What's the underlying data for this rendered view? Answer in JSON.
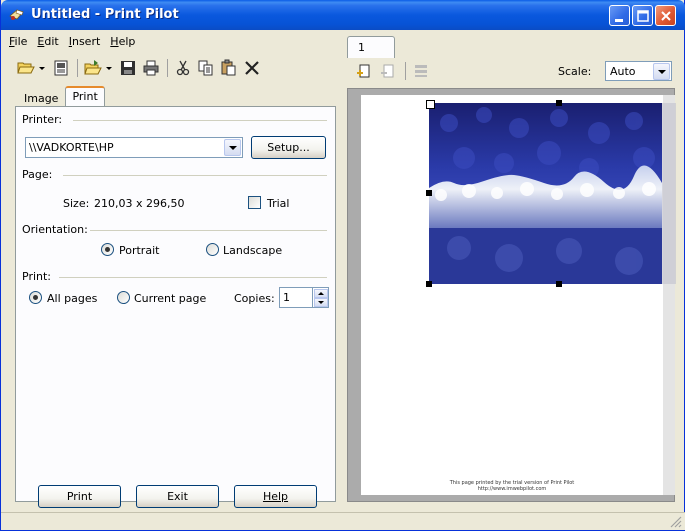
{
  "window": {
    "title": "Untitled - Print Pilot"
  },
  "menu": {
    "items": [
      {
        "label": "File",
        "accel": "F",
        "rest": "ile"
      },
      {
        "label": "Edit",
        "accel": "E",
        "rest": "dit"
      },
      {
        "label": "Insert",
        "accel": "I",
        "rest": "nsert"
      },
      {
        "label": "Help",
        "accel": "H",
        "rest": "elp"
      }
    ]
  },
  "toolbar": {
    "icons": [
      "open-folder-icon",
      "page-setup-icon",
      "import-icon",
      "save-icon",
      "print-icon",
      "cut-icon",
      "copy-icon",
      "paste-icon",
      "delete-icon"
    ]
  },
  "left_tabs": {
    "image": "Image",
    "print": "Print"
  },
  "printer": {
    "group_label": "Printer:",
    "selected": "\\\\VADKORTE\\HP",
    "setup_button": "Setup..."
  },
  "page": {
    "group_label": "Page:",
    "size_label": "Size:",
    "size_value": "210,03 x 296,50",
    "trial_label": "Trial",
    "trial_checked": false
  },
  "orientation": {
    "group_label": "Orientation:",
    "portrait": "Portrait",
    "landscape": "Landscape",
    "selected": "portrait"
  },
  "print_range": {
    "group_label": "Print:",
    "all_pages": "All pages",
    "current_page": "Current page",
    "selected": "all",
    "copies_label": "Copies:",
    "copies_value": "1"
  },
  "buttons": {
    "print": "Print",
    "exit": "Exit",
    "help": "Help"
  },
  "preview": {
    "page_tab": "1",
    "scale_label": "Scale:",
    "scale_value": "Auto",
    "footer_line1": "This page printed by the trial version of Print Pilot",
    "footer_line2": "http://www.imwebpilot.com"
  },
  "colors": {
    "titlebar": "#0a58de",
    "photo_sky": "#1f2f9a",
    "photo_snow": "#e8ecf4"
  }
}
